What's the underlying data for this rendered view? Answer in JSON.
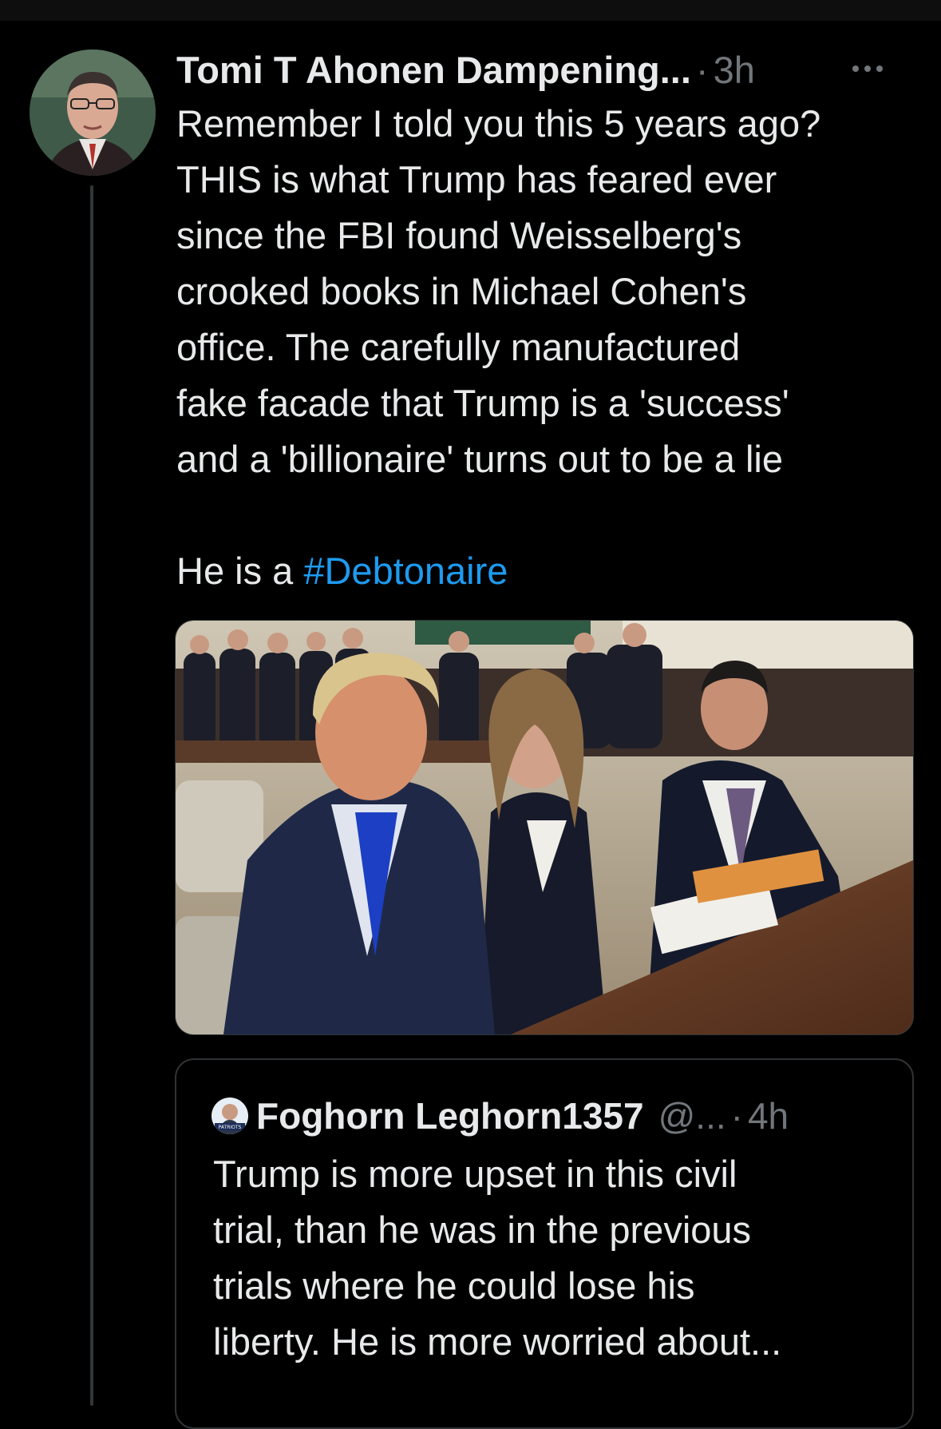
{
  "tweet": {
    "author_name": "Tomi T Ahonen Dampening...",
    "time": "3h",
    "text_lines": [
      "Remember I told you this 5 years ago?",
      "THIS is what Trump has feared ever",
      "since the FBI found Weisselberg's",
      "crooked books in Michael Cohen's",
      "office. The carefully manufactured",
      "fake facade that Trump is a 'success'",
      "and a 'billionaire' turns out to be a lie"
    ],
    "final_line_prefix": "He is a ",
    "hashtag": "#Debtonaire",
    "more_icon": "ellipsis-icon",
    "image": "courtroom-photo"
  },
  "quoted_tweet": {
    "author_name": "Foghorn Leghorn1357",
    "handle": "@...",
    "time": "4h",
    "avatar_caption": "PATRIOTS",
    "text_lines": [
      "Trump is more upset in this civil",
      "trial, than he was in the previous",
      "trials where he could lose his",
      "liberty. He is more worried about..."
    ]
  },
  "colors": {
    "background": "#000000",
    "text": "#e7e9ea",
    "muted": "#71767b",
    "link": "#1d9bf0",
    "border": "#2f3336"
  }
}
